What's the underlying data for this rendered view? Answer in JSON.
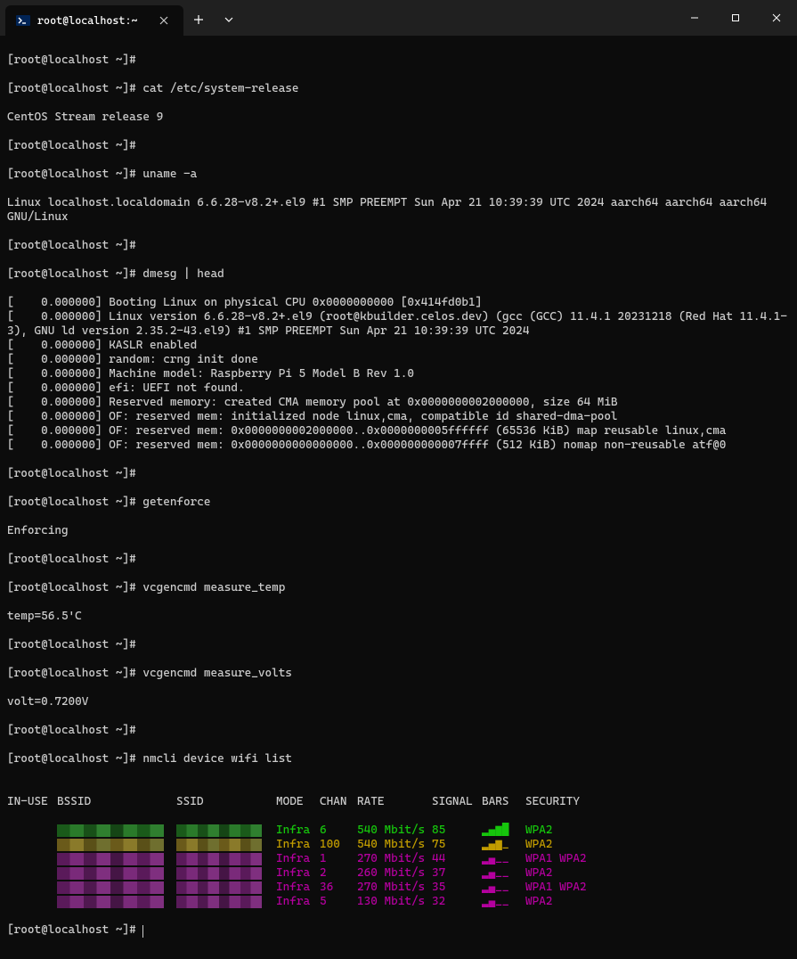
{
  "titlebar": {
    "tab_title": "root@localhost:~"
  },
  "prompt": "[root@localhost ~]#",
  "prompt_blank": "[root@localhost ~]# ",
  "commands": {
    "cat_release": "[root@localhost ~]# cat /etc/system-release",
    "uname": "[root@localhost ~]# uname -a",
    "dmesg": "[root@localhost ~]# dmesg | head",
    "getenforce": "[root@localhost ~]# getenforce",
    "vcgencmd_temp": "[root@localhost ~]# vcgencmd measure_temp",
    "vcgencmd_volts": "[root@localhost ~]# vcgencmd measure_volts",
    "nmcli": "[root@localhost ~]# nmcli device wifi list"
  },
  "outputs": {
    "release": "CentOS Stream release 9",
    "uname": "Linux localhost.localdomain 6.6.28-v8.2+.el9 #1 SMP PREEMPT Sun Apr 21 10:39:39 UTC 2024 aarch64 aarch64 aarch64 GNU/Linux",
    "dmesg": [
      "[    0.000000] Booting Linux on physical CPU 0x0000000000 [0x414fd0b1]",
      "[    0.000000] Linux version 6.6.28-v8.2+.el9 (root@kbuilder.celos.dev) (gcc (GCC) 11.4.1 20231218 (Red Hat 11.4.1-3), GNU ld version 2.35.2-43.el9) #1 SMP PREEMPT Sun Apr 21 10:39:39 UTC 2024",
      "[    0.000000] KASLR enabled",
      "[    0.000000] random: crng init done",
      "[    0.000000] Machine model: Raspberry Pi 5 Model B Rev 1.0",
      "[    0.000000] efi: UEFI not found.",
      "[    0.000000] Reserved memory: created CMA memory pool at 0x0000000002000000, size 64 MiB",
      "[    0.000000] OF: reserved mem: initialized node linux,cma, compatible id shared-dma-pool",
      "[    0.000000] OF: reserved mem: 0x0000000002000000..0x0000000005ffffff (65536 KiB) map reusable linux,cma",
      "[    0.000000] OF: reserved mem: 0x0000000000000000..0x000000000007ffff (512 KiB) nomap non-reusable atf@0"
    ],
    "getenforce": "Enforcing",
    "temp": "temp=56.5'C",
    "volts": "volt=0.7200V"
  },
  "wifi": {
    "headers": {
      "inuse": "IN-USE",
      "bssid": "BSSID",
      "ssid": "SSID",
      "mode": "MODE",
      "chan": "CHAN",
      "rate": "RATE",
      "signal": "SIGNAL",
      "bars": "BARS",
      "security": "SECURITY"
    },
    "rows": [
      {
        "mode": "Infra",
        "chan": "6",
        "rate": "540 Mbit/s",
        "signal": "85",
        "bars": "▂▄▆█",
        "security": "WPA2",
        "color": "green"
      },
      {
        "mode": "Infra",
        "chan": "100",
        "rate": "540 Mbit/s",
        "signal": "75",
        "bars": "▂▄▆_",
        "security": "WPA2",
        "color": "yellow"
      },
      {
        "mode": "Infra",
        "chan": "1",
        "rate": "270 Mbit/s",
        "signal": "44",
        "bars": "▂▄__",
        "security": "WPA1 WPA2",
        "color": "magenta"
      },
      {
        "mode": "Infra",
        "chan": "2",
        "rate": "260 Mbit/s",
        "signal": "37",
        "bars": "▂▄__",
        "security": "WPA2",
        "color": "magenta"
      },
      {
        "mode": "Infra",
        "chan": "36",
        "rate": "270 Mbit/s",
        "signal": "35",
        "bars": "▂▄__",
        "security": "WPA1 WPA2",
        "color": "magenta"
      },
      {
        "mode": "Infra",
        "chan": "5",
        "rate": "130 Mbit/s",
        "signal": "32",
        "bars": "▂▄__",
        "security": "WPA2",
        "color": "magenta"
      }
    ]
  }
}
